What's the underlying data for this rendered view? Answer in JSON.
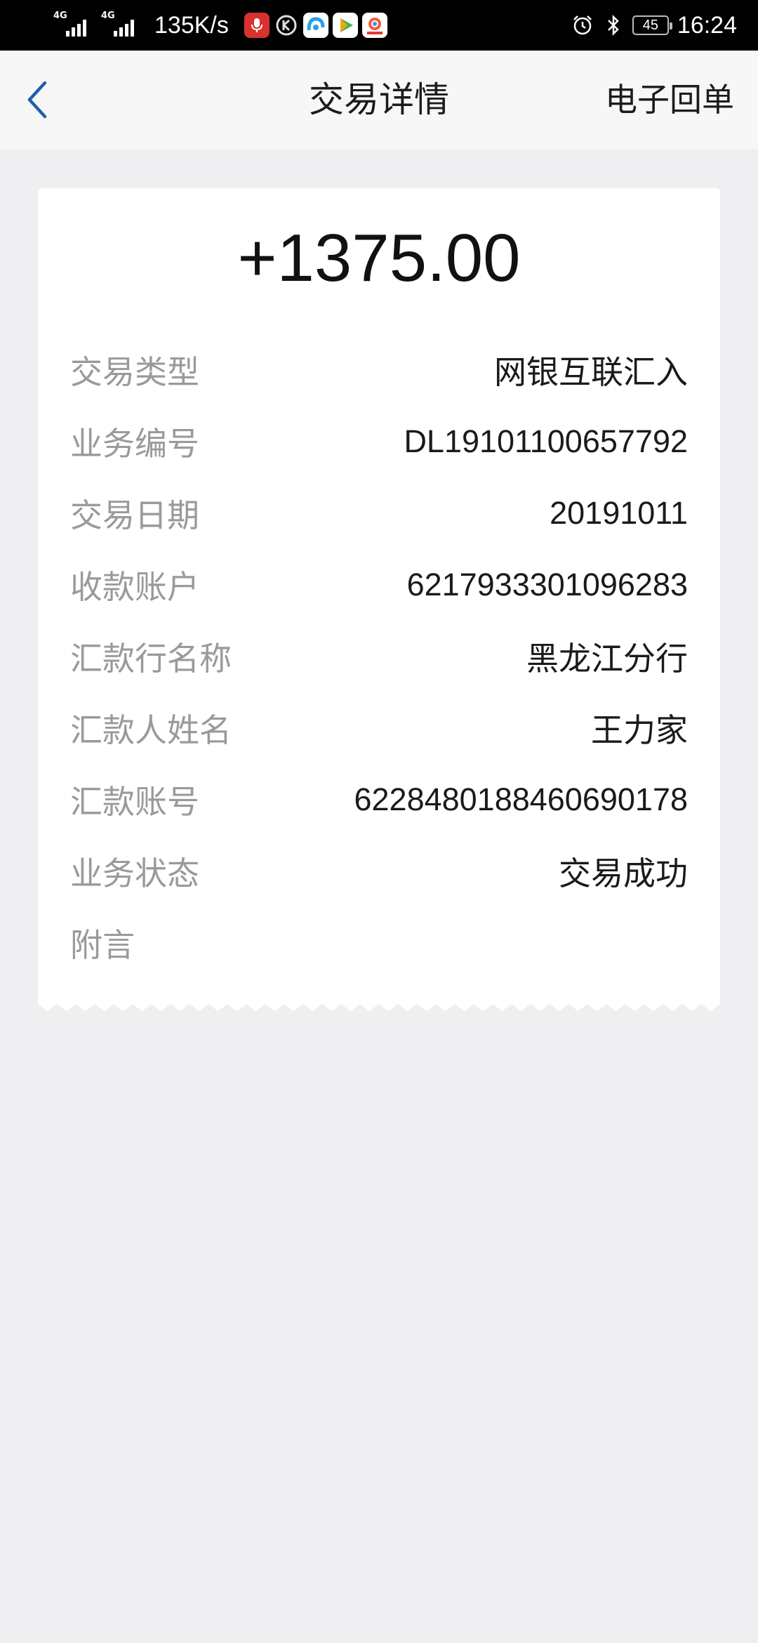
{
  "status_bar": {
    "network_1": "4G",
    "network_2": "4G",
    "net_speed": "135K/s",
    "battery": "45",
    "time": "16:24",
    "app_icons": [
      "mic-app-icon",
      "k-app-icon",
      "browser-app-icon",
      "video-app-icon",
      "photo-app-icon"
    ]
  },
  "header": {
    "title": "交易详情",
    "receipt_label": "电子回单",
    "accent_color": "#1f5fa8"
  },
  "transaction": {
    "amount": "+1375.00",
    "rows": [
      {
        "label": "交易类型",
        "value": "网银互联汇入"
      },
      {
        "label": "业务编号",
        "value": "DL19101100657792"
      },
      {
        "label": "交易日期",
        "value": "20191011"
      },
      {
        "label": "收款账户",
        "value": "6217933301096283"
      },
      {
        "label": "汇款行名称",
        "value": "黑龙江分行"
      },
      {
        "label": "汇款人姓名",
        "value": "王力家"
      },
      {
        "label": "汇款账号",
        "value": "6228480188460690178"
      },
      {
        "label": "业务状态",
        "value": "交易成功"
      },
      {
        "label": "附言",
        "value": ""
      }
    ]
  }
}
